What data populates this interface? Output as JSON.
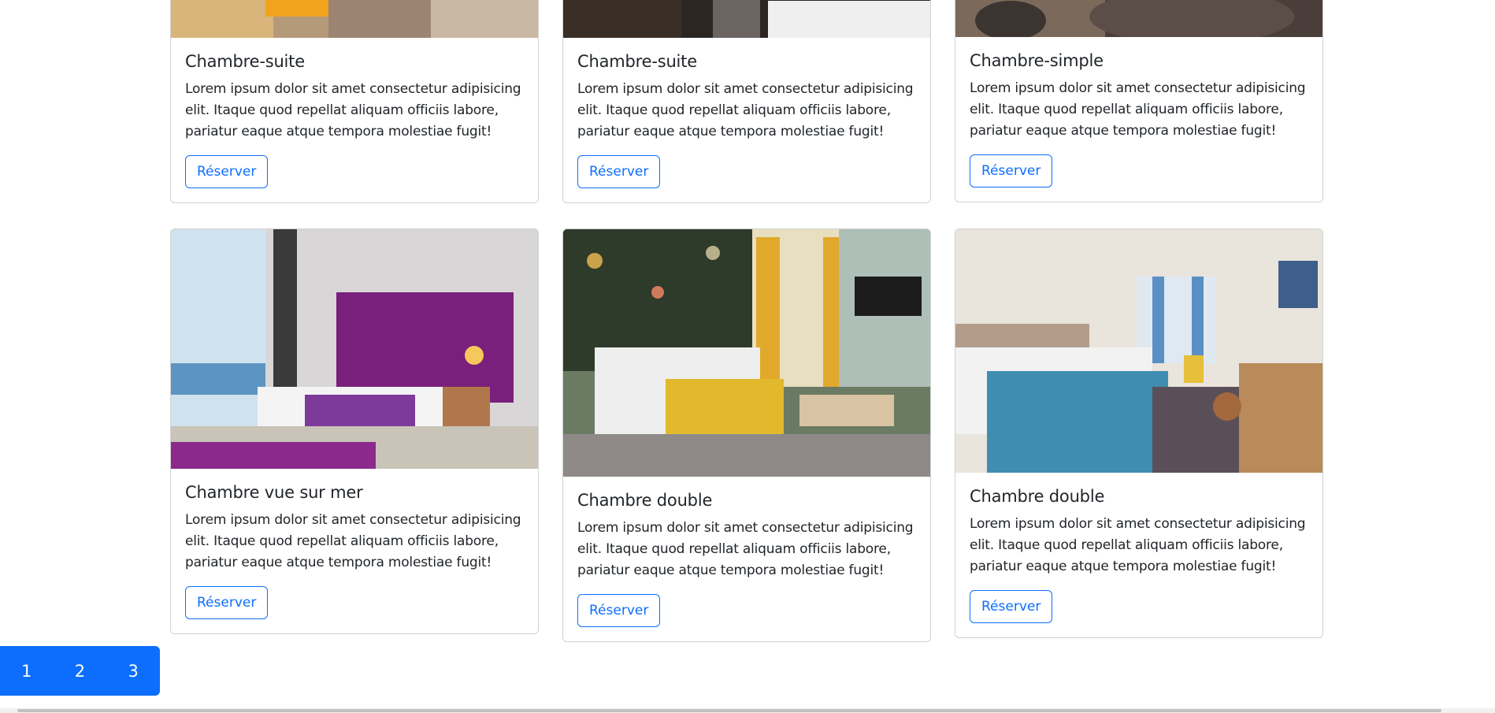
{
  "cards": [
    {
      "title": "Chambre-suite",
      "text": "Lorem ipsum dolor sit amet consectetur adipisicing elit. Itaque quod repellat aliquam officiis labore, pariatur eaque atque tempora molestiae fugit!",
      "button": "Réserver"
    },
    {
      "title": "Chambre-suite",
      "text": "Lorem ipsum dolor sit amet consectetur adipisicing elit. Itaque quod repellat aliquam officiis labore, pariatur eaque atque tempora molestiae fugit!",
      "button": "Réserver"
    },
    {
      "title": "Chambre-simple",
      "text": "Lorem ipsum dolor sit amet consectetur adipisicing elit. Itaque quod repellat aliquam officiis labore, pariatur eaque atque tempora molestiae fugit!",
      "button": "Réserver"
    },
    {
      "title": "Chambre vue sur mer",
      "text": "Lorem ipsum dolor sit amet consectetur adipisicing elit. Itaque quod repellat aliquam officiis labore, pariatur eaque atque tempora molestiae fugit!",
      "button": "Réserver"
    },
    {
      "title": "Chambre double",
      "text": "Lorem ipsum dolor sit amet consectetur adipisicing elit. Itaque quod repellat aliquam officiis labore, pariatur eaque atque tempora molestiae fugit!",
      "button": "Réserver"
    },
    {
      "title": "Chambre double",
      "text": "Lorem ipsum dolor sit amet consectetur adipisicing elit. Itaque quod repellat aliquam officiis labore, pariatur eaque atque tempora molestiae fugit!",
      "button": "Réserver"
    }
  ],
  "pagination": [
    "1",
    "2",
    "3"
  ],
  "colors": {
    "primary": "#0d6efd",
    "border": "#dee2e6"
  }
}
